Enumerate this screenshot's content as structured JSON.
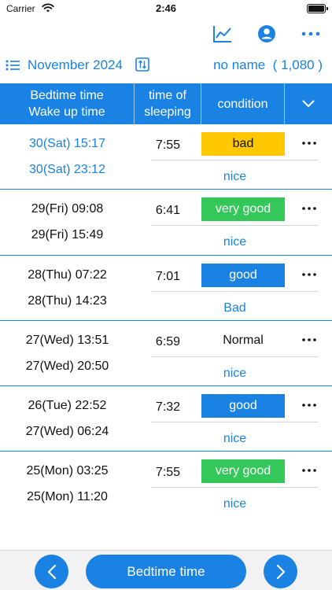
{
  "status": {
    "carrier": "Carrier",
    "time": "2:46"
  },
  "toolbar": {
    "icons": [
      "chart-icon",
      "profile-icon",
      "more-icon"
    ]
  },
  "month_row": {
    "month": "November 2024",
    "profile": "no name  ( 1,080 )"
  },
  "table": {
    "headers": {
      "times_line1": "Bedtime time",
      "times_line2": "Wake up time",
      "sleep_line1": "time of",
      "sleep_line2": "sleeping",
      "condition": "condition"
    },
    "rows": [
      {
        "bed": "30(Sat) 15:17",
        "wake": "30(Sat) 23:12",
        "duration": "7:55",
        "condition": "bad",
        "quality": "nice",
        "highlight": true
      },
      {
        "bed": "29(Fri) 09:08",
        "wake": "29(Fri) 15:49",
        "duration": "6:41",
        "condition": "very good",
        "quality": "nice",
        "highlight": false
      },
      {
        "bed": "28(Thu) 07:22",
        "wake": "28(Thu) 14:23",
        "duration": "7:01",
        "condition": "good",
        "quality": "Bad",
        "highlight": false
      },
      {
        "bed": "27(Wed) 13:51",
        "wake": "27(Wed) 20:50",
        "duration": "6:59",
        "condition": "Normal",
        "quality": "nice",
        "highlight": false
      },
      {
        "bed": "26(Tue) 22:52",
        "wake": "27(Wed) 06:24",
        "duration": "7:32",
        "condition": "good",
        "quality": "nice",
        "highlight": false
      },
      {
        "bed": "25(Mon) 03:25",
        "wake": "25(Mon) 11:20",
        "duration": "7:55",
        "condition": "very good",
        "quality": "nice",
        "highlight": false
      }
    ]
  },
  "bottom": {
    "main_button": "Bedtime time"
  },
  "colors": {
    "accent": "#1a82e2",
    "bad": "#ffc800",
    "very_good": "#34c759",
    "good": "#1a82e2"
  }
}
